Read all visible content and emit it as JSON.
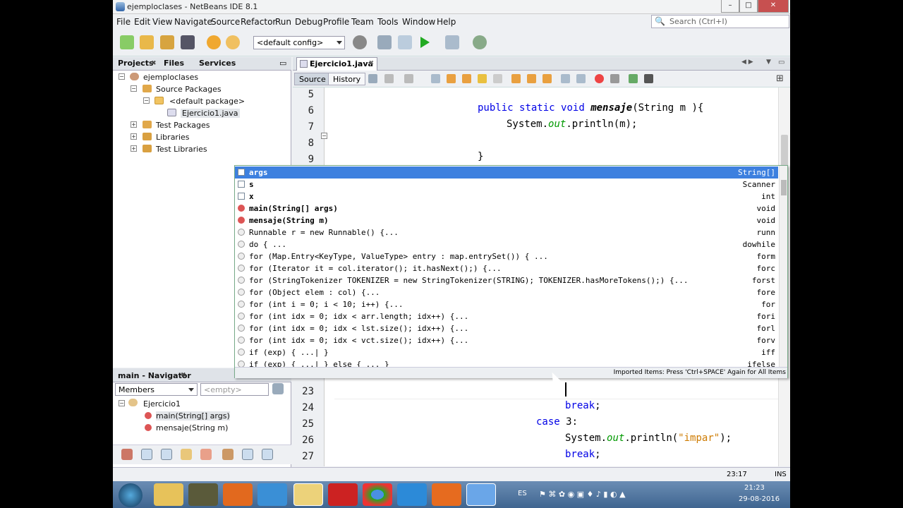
{
  "window": {
    "title": "ejemploclases - NetBeans IDE 8.1",
    "controls": {
      "minimize": "–",
      "maximize": "□",
      "close": "✕"
    }
  },
  "menu": [
    "File",
    "Edit",
    "View",
    "Navigate",
    "Source",
    "Refactor",
    "Run",
    "Debug",
    "Profile",
    "Team",
    "Tools",
    "Window",
    "Help"
  ],
  "search": {
    "placeholder": "Search (Ctrl+I)"
  },
  "toolbar": {
    "config": "<default config>"
  },
  "projects_panel": {
    "tabs": [
      "Projects",
      "Files",
      "Services"
    ],
    "tree": [
      "ejemploclases",
      "Source Packages",
      "<default package>",
      "Ejercicio1.java",
      "Test Packages",
      "Libraries",
      "Test Libraries"
    ]
  },
  "navigator": {
    "title": "main - Navigator",
    "filter": "Members",
    "empty": "<empty>",
    "tree": [
      "Ejercicio1",
      "main(String[] args)",
      "mensaje(String m)"
    ]
  },
  "editor": {
    "tab": "Ejercicio1.java",
    "source_btn": "Source",
    "history_btn": "History",
    "top_lines": [
      "5",
      "6",
      "7",
      "8",
      "9"
    ],
    "bottom_lines": [
      "23",
      "24",
      "25",
      "26",
      "27"
    ]
  },
  "completion": {
    "items": [
      {
        "text": "args",
        "ret": "String[]",
        "icon": "field"
      },
      {
        "text": "s",
        "ret": "Scanner",
        "icon": "field"
      },
      {
        "text": "x",
        "ret": "int",
        "icon": "field"
      },
      {
        "text": "main(String[] args)",
        "ret": "void",
        "icon": "method"
      },
      {
        "text": "mensaje(String m)",
        "ret": "void",
        "icon": "method"
      },
      {
        "text": "Runnable r = new Runnable() {...",
        "ret": "runn",
        "icon": "template"
      },
      {
        "text": "do { ...",
        "ret": "dowhile",
        "icon": "template"
      },
      {
        "text": "for (Map.Entry<KeyType, ValueType> entry : map.entrySet()) { ...",
        "ret": "form",
        "icon": "template"
      },
      {
        "text": "for (Iterator it = col.iterator(); it.hasNext();) {...",
        "ret": "forc",
        "icon": "template"
      },
      {
        "text": "for (StringTokenizer TOKENIZER = new StringTokenizer(STRING); TOKENIZER.hasMoreTokens();) {...",
        "ret": "forst",
        "icon": "template"
      },
      {
        "text": "for (Object elem : col) {...",
        "ret": "fore",
        "icon": "template"
      },
      {
        "text": "for (int i = 0; i < 10; i++) {...",
        "ret": "for",
        "icon": "template"
      },
      {
        "text": "for (int idx = 0; idx < arr.length; idx++) {...",
        "ret": "fori",
        "icon": "template"
      },
      {
        "text": "for (int idx = 0; idx < lst.size(); idx++) {...",
        "ret": "forl",
        "icon": "template"
      },
      {
        "text": "for (int idx = 0; idx < vct.size(); idx++) {...",
        "ret": "forv",
        "icon": "template"
      },
      {
        "text": "if (exp) { ...| }",
        "ret": "iff",
        "icon": "template"
      },
      {
        "text": "if (exp) { ...| } else { ... }",
        "ret": "ifelse",
        "icon": "template"
      }
    ],
    "footer": "Imported Items: Press 'Ctrl+SPACE' Again for All Items"
  },
  "status": {
    "position": "23:17",
    "mode": "INS"
  },
  "taskbar": {
    "lang": "ES",
    "time": "21:23",
    "date": "29-08-2016"
  }
}
